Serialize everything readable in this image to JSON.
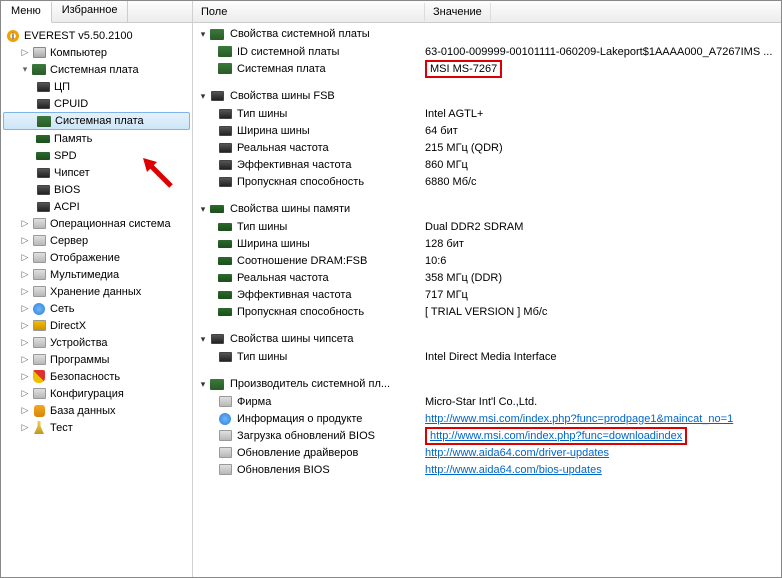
{
  "tabs": {
    "menu": "Меню",
    "favorites": "Избранное"
  },
  "tree": {
    "root": "EVEREST v5.50.2100",
    "computer": "Компьютер",
    "motherboard": "Системная плата",
    "cpu": "ЦП",
    "cpuid": "CPUID",
    "mb": "Системная плата",
    "memory": "Память",
    "spd": "SPD",
    "chipset": "Чипсет",
    "bios": "BIOS",
    "acpi": "ACPI",
    "os": "Операционная система",
    "server": "Сервер",
    "display": "Отображение",
    "mm": "Мультимедиа",
    "storage": "Хранение данных",
    "network": "Сеть",
    "directx": "DirectX",
    "devices": "Устройства",
    "programs": "Программы",
    "security": "Безопасность",
    "config": "Конфигурация",
    "db": "База данных",
    "test": "Тест"
  },
  "columns": {
    "field": "Поле",
    "value": "Значение"
  },
  "groups": {
    "mb_props": "Свойства системной платы",
    "fsb_props": "Свойства шины FSB",
    "mem_props": "Свойства шины памяти",
    "chipset_props": "Свойства шины чипсета",
    "mfr": "Производитель системной пл..."
  },
  "mb_props": {
    "id_label": "ID системной платы",
    "id_value": "63-0100-009999-00101111-060209-Lakeport$1AAAA000_A7267IMS ...",
    "mb_label": "Системная плата",
    "mb_value": "MSI MS-7267"
  },
  "fsb_props": {
    "bus_type_label": "Тип шины",
    "bus_type_value": "Intel AGTL+",
    "bus_width_label": "Ширина шины",
    "bus_width_value": "64 бит",
    "real_clock_label": "Реальная частота",
    "real_clock_value": "215 МГц (QDR)",
    "eff_clock_label": "Эффективная частота",
    "eff_clock_value": "860 МГц",
    "bandwidth_label": "Пропускная способность",
    "bandwidth_value": "6880 Мб/с"
  },
  "mem_props": {
    "bus_type_label": "Тип шины",
    "bus_type_value": "Dual DDR2 SDRAM",
    "bus_width_label": "Ширина шины",
    "bus_width_value": "128 бит",
    "ratio_label": "Соотношение DRAM:FSB",
    "ratio_value": "10:6",
    "real_clock_label": "Реальная частота",
    "real_clock_value": "358 МГц (DDR)",
    "eff_clock_label": "Эффективная частота",
    "eff_clock_value": "717 МГц",
    "bandwidth_label": "Пропускная способность",
    "bandwidth_value": "[ TRIAL VERSION ] Мб/с"
  },
  "chipset_props": {
    "bus_type_label": "Тип шины",
    "bus_type_value": "Intel Direct Media Interface"
  },
  "mfr": {
    "company_label": "Фирма",
    "company_value": "Micro-Star Int'l Co.,Ltd.",
    "product_label": "Информация о продукте",
    "product_value": "http://www.msi.com/index.php?func=prodpage1&maincat_no=1",
    "bios_label": "Загрузка обновлений BIOS",
    "bios_value": "http://www.msi.com/index.php?func=downloadindex",
    "driver_label": "Обновление драйверов",
    "driver_value": "http://www.aida64.com/driver-updates",
    "biosupd_label": "Обновления BIOS",
    "biosupd_value": "http://www.aida64.com/bios-updates"
  }
}
